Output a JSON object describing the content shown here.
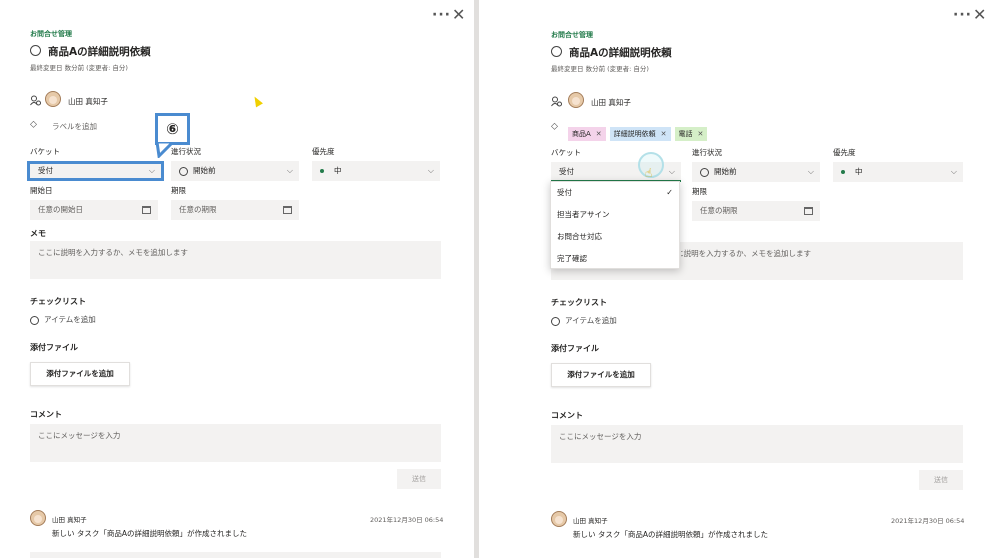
{
  "left": {
    "plan": "お問合せ管理",
    "task_title": "商品Aの詳細説明依頼",
    "modified": "最終変更日 数分前 (変更者: 自分)",
    "assignee": "山田 真知子",
    "add_label": "ラベルを追加",
    "callout_number": "⑥",
    "bucket_label": "バケット",
    "bucket_value": "受付",
    "progress_label": "進行状況",
    "progress_value": "開始前",
    "priority_label": "優先度",
    "priority_value": "中",
    "start_label": "開始日",
    "start_placeholder": "任意の開始日",
    "due_label": "期限",
    "due_placeholder": "任意の期限",
    "memo_label": "メモ",
    "memo_placeholder": "ここに説明を入力するか、メモを追加します",
    "checklist_label": "チェックリスト",
    "checklist_add": "アイテムを追加",
    "attach_label": "添付ファイル",
    "attach_button": "添付ファイルを追加",
    "comment_label": "コメント",
    "comment_placeholder": "ここにメッセージを入力",
    "send_button": "送信",
    "comment_author": "山田 真知子",
    "comment_time": "2021年12月30日 06:54",
    "comment_text": "新しい タスク「商品Aの詳細説明依頼」が作成されました"
  },
  "right": {
    "plan": "お問合せ管理",
    "task_title": "商品Aの詳細説明依頼",
    "modified": "最終変更日 数分前 (変更者: 自分)",
    "assignee": "山田 真知子",
    "tags": [
      {
        "label": "商品A",
        "color": "#f4d3ea"
      },
      {
        "label": "詳細説明依頼",
        "color": "#cfe4f7"
      },
      {
        "label": "電話",
        "color": "#d5efc8"
      }
    ],
    "bucket_label": "バケット",
    "bucket_value": "受付",
    "progress_label": "進行状況",
    "progress_value": "開始前",
    "priority_label": "優先度",
    "priority_value": "中",
    "due_label": "期限",
    "due_placeholder": "任意の期限",
    "memo_placeholder_tail": "ここに説明を入力するか、メモを追加します",
    "dropdown": [
      "受付",
      "担当者アサイン",
      "お問合せ対応",
      "完了確認"
    ],
    "checklist_label": "チェックリスト",
    "checklist_add": "アイテムを追加",
    "attach_label": "添付ファイル",
    "attach_button": "添付ファイルを追加",
    "comment_label": "コメント",
    "comment_placeholder": "ここにメッセージを入力",
    "send_button": "送信",
    "comment_author": "山田 真知子",
    "comment_time": "2021年12月30日 06:54",
    "comment_text": "新しい タスク「商品Aの詳細説明依頼」が作成されました"
  },
  "window": {
    "more": "···",
    "close": "✕"
  },
  "colors": {
    "accent": "#237b4b",
    "callout": "#4a8bd0"
  }
}
